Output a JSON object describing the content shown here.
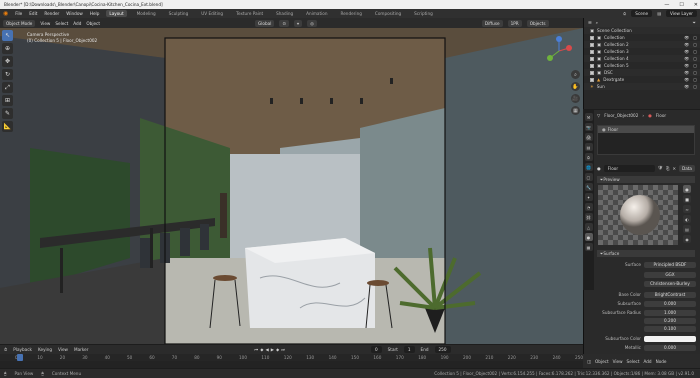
{
  "titlebar": {
    "title": "Blender* [D:\\Downloads\\_Blender\\Canopi\\Cocina-Kitchen_Cocina_Ext.blend]",
    "min": "—",
    "max": "☐",
    "close": "✕"
  },
  "menubar": {
    "menus": [
      "File",
      "Edit",
      "Render",
      "Window",
      "Help"
    ],
    "workspaces": [
      "Layout",
      "Modeling",
      "Sculpting",
      "UV Editing",
      "Texture Paint",
      "Shading",
      "Animation",
      "Rendering",
      "Compositing",
      "Scripting"
    ],
    "active_workspace": "Layout",
    "scene_label": "Scene",
    "view_layer": "View Layer"
  },
  "header3d": {
    "mode": "Object Mode",
    "menus": [
      "View",
      "Select",
      "Add",
      "Object"
    ],
    "orientation": "Global",
    "right_btns": [
      "Diffuse",
      "1PR",
      "Objects"
    ]
  },
  "viewport": {
    "info_line1": "Camera Perspective",
    "info_line2": "(0) Collection 5 | Floor_Object002"
  },
  "tools": [
    "arrow-icon",
    "cursor-icon",
    "move-icon",
    "rotate-icon",
    "scale-icon",
    "transform-icon",
    "annotate-icon",
    "measure-icon"
  ],
  "outliner": {
    "header": "Scene Collection",
    "rows": [
      {
        "label": "Scene Collection"
      },
      {
        "label": "Collection"
      },
      {
        "label": "Collection 2"
      },
      {
        "label": "Collection 3"
      },
      {
        "label": "Collection 4"
      },
      {
        "label": "Collection 5"
      },
      {
        "label": "DSC"
      },
      {
        "label": "Dextrgate"
      },
      {
        "label": "Sun"
      }
    ]
  },
  "properties": {
    "object": "Floor_Object002",
    "material_tab": "Floor",
    "slot": "Floor",
    "material_name": "Floor",
    "data_btn": "Data",
    "preview_label": "Preview",
    "surface_label": "Surface",
    "surface": "Principled BSDF",
    "distribution": "GGX",
    "subsurface_method": "Christensen-Burley",
    "rows": [
      {
        "label": "Base Color",
        "value": "BrightContrast",
        "style": "normal"
      },
      {
        "label": "Subsurface",
        "value": "0.000",
        "style": "normal"
      },
      {
        "label": "Subsurface Radius",
        "value": "1.000",
        "style": "normal"
      },
      {
        "label": "",
        "value": "0.200",
        "style": "normal"
      },
      {
        "label": "",
        "value": "0.100",
        "style": "normal"
      },
      {
        "label": "Subsurface Color",
        "value": "",
        "style": "white"
      },
      {
        "label": "Metallic",
        "value": "0.000",
        "style": "normal"
      }
    ]
  },
  "timeline": {
    "menus": [
      "Playback",
      "Keying",
      "View",
      "Marker"
    ],
    "current_frame": "0",
    "start_label": "Start",
    "start": "1",
    "end_label": "End",
    "end": "250",
    "ticks": [
      "0",
      "10",
      "20",
      "30",
      "40",
      "50",
      "60",
      "70",
      "80",
      "90",
      "100",
      "110",
      "120",
      "130",
      "140",
      "150",
      "160",
      "170",
      "180",
      "190",
      "200",
      "210",
      "220",
      "230",
      "240",
      "250"
    ]
  },
  "bottom_right": {
    "menus": [
      "Object",
      "View",
      "Select",
      "Add",
      "Node"
    ]
  },
  "statusbar": {
    "items": [
      "Pan View",
      "Context Menu"
    ],
    "stats": "Collection 5 | Floor_Object002 | Verts:6.154.255 | Faces:6.178.262 | Tris:12.336.362 | Objects:1/86 | Mem: 3.08 GB | v2.91.0"
  },
  "colors": {
    "accent": "#4772b3",
    "active_orange": "#e8a33c"
  }
}
